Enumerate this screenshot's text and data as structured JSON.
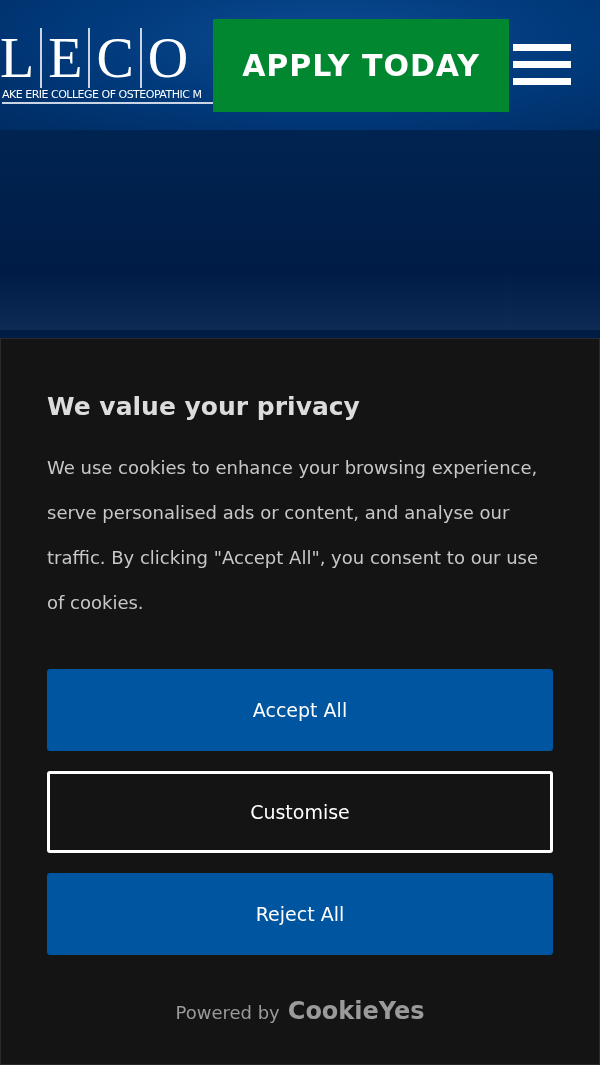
{
  "header": {
    "logo_letters": [
      "L",
      "E",
      "C",
      "O"
    ],
    "logo_subtitle": "AKE ERIE COLLEGE OF OSTEOPATHIC M",
    "apply_button": "APPLY TODAY"
  },
  "consent": {
    "title": "We value your privacy",
    "message": "We use cookies to enhance your browsing experience, serve personalised ads or content, and analyse our traffic. By clicking \"Accept All\", you consent to our use of cookies.",
    "buttons": [
      {
        "label": "Accept All",
        "kind": "filled"
      },
      {
        "label": "Customise",
        "kind": "outline"
      },
      {
        "label": "Reject All",
        "kind": "filled"
      }
    ],
    "powered_by": "Powered by",
    "brand": "CookieYes"
  }
}
